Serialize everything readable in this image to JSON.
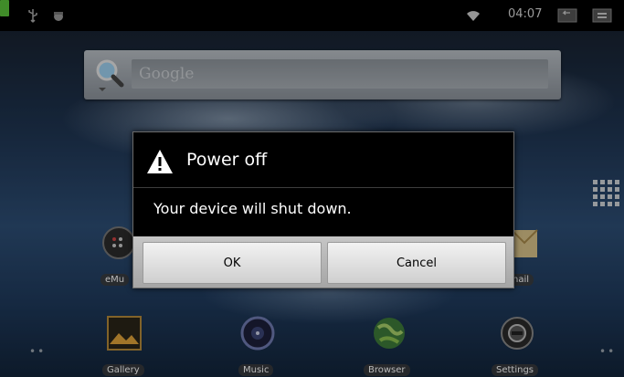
{
  "status_bar": {
    "time": "04:07",
    "icons": [
      "usb-icon",
      "debug-icon",
      "wifi-icon",
      "battery-icon",
      "back-icon",
      "menu-icon"
    ]
  },
  "search": {
    "placeholder": "Google",
    "icon": "search-icon"
  },
  "home": {
    "shortcuts": [
      {
        "label": "eMu",
        "icon": "emu-app-icon"
      },
      {
        "label": "nail",
        "icon": "email-app-icon"
      }
    ],
    "dock": [
      {
        "label": "Gallery",
        "icon": "gallery-icon"
      },
      {
        "label": "Music",
        "icon": "music-icon"
      },
      {
        "label": "Browser",
        "icon": "browser-icon"
      },
      {
        "label": "Settings",
        "icon": "settings-icon"
      }
    ],
    "apps_icon": "apps-grid-icon"
  },
  "dialog": {
    "title": "Power off",
    "message": "Your device will shut down.",
    "ok_label": "OK",
    "cancel_label": "Cancel",
    "icon": "warning-icon"
  },
  "colors": {
    "battery": "#59c23a",
    "dialog_bg": "#000000",
    "button_bar": "#b5b5b5"
  }
}
